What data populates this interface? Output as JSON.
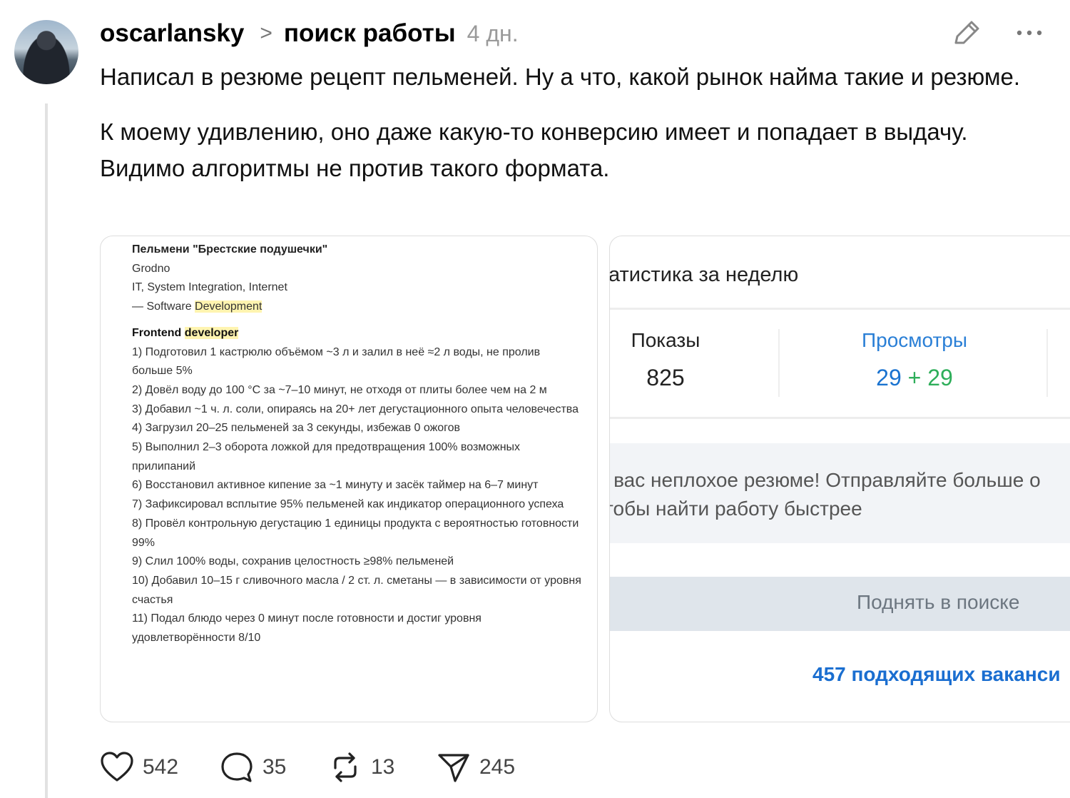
{
  "post": {
    "username": "oscarlansky",
    "community": "поиск работы",
    "time": "4 дн.",
    "paragraphs": [
      "Написал в резюме рецепт пельменей. Ну а что, какой рынок найма такие и резюме.",
      "К моему удивлению, оно даже какую-то конверсию имеет и попадает в выдачу. Видимо алгоритмы не против такого формата."
    ]
  },
  "resume": {
    "title": "Пельмени \"Брестские подушечки\"",
    "city": "Grodno",
    "industry": "IT, System Integration, Internet",
    "sub_prefix": "— Software ",
    "sub_highlight": "Development",
    "section_prefix": "Frontend ",
    "section_highlight": "developer",
    "steps": [
      "1) Подготовил 1 кастрюлю объёмом ~3 л и залил в неё ≈2 л воды, не пролив больше 5%",
      "2) Довёл воду до 100 °C за ~7–10 минут, не отходя от плиты более чем на 2 м",
      "3) Добавил ~1 ч. л. соли, опираясь на 20+ лет дегустационного опыта человечества",
      "4) Загрузил 20–25 пельменей за 3 секунды, избежав 0 ожогов",
      "5) Выполнил 2–3 оборота ложкой для предотвращения 100% возможных прилипаний",
      "6) Восстановил активное кипение за ~1 минуту и засёк таймер на 6–7 минут",
      "7) Зафиксировал всплытие 95% пельменей как индикатор операционного успеха",
      "8) Провёл контрольную дегустацию 1 единицы продукта с вероятностью готовности 99%",
      "9) Слил 100% воды, сохранив целостность ≥98% пельменей",
      "10) Добавил 10–15 г сливочного масла / 2 ст. л. сметаны — в зависимости от уровня счастья",
      "11) Подал блюдо через 0 минут после готовности и достиг уровня удовлетворённости 8/10"
    ]
  },
  "stats": {
    "title": "атистика за неделю",
    "shows_label": "Показы",
    "shows_value": "825",
    "views_label": "Просмотры",
    "views_a": "29",
    "views_plus": "+",
    "views_b": "29",
    "tip_line1": "' вас неплохое резюме! Отправляйте больше о",
    "tip_line2": "тобы найти работу быстрее",
    "raise_label": "Поднять в поиске",
    "vacancies": "457 подходящих ваканси"
  },
  "actions": {
    "likes": "542",
    "comments": "35",
    "reposts": "13",
    "shares": "245"
  },
  "colors": {
    "accent_blue": "#1a73d0",
    "accent_green": "#2eae5a"
  }
}
